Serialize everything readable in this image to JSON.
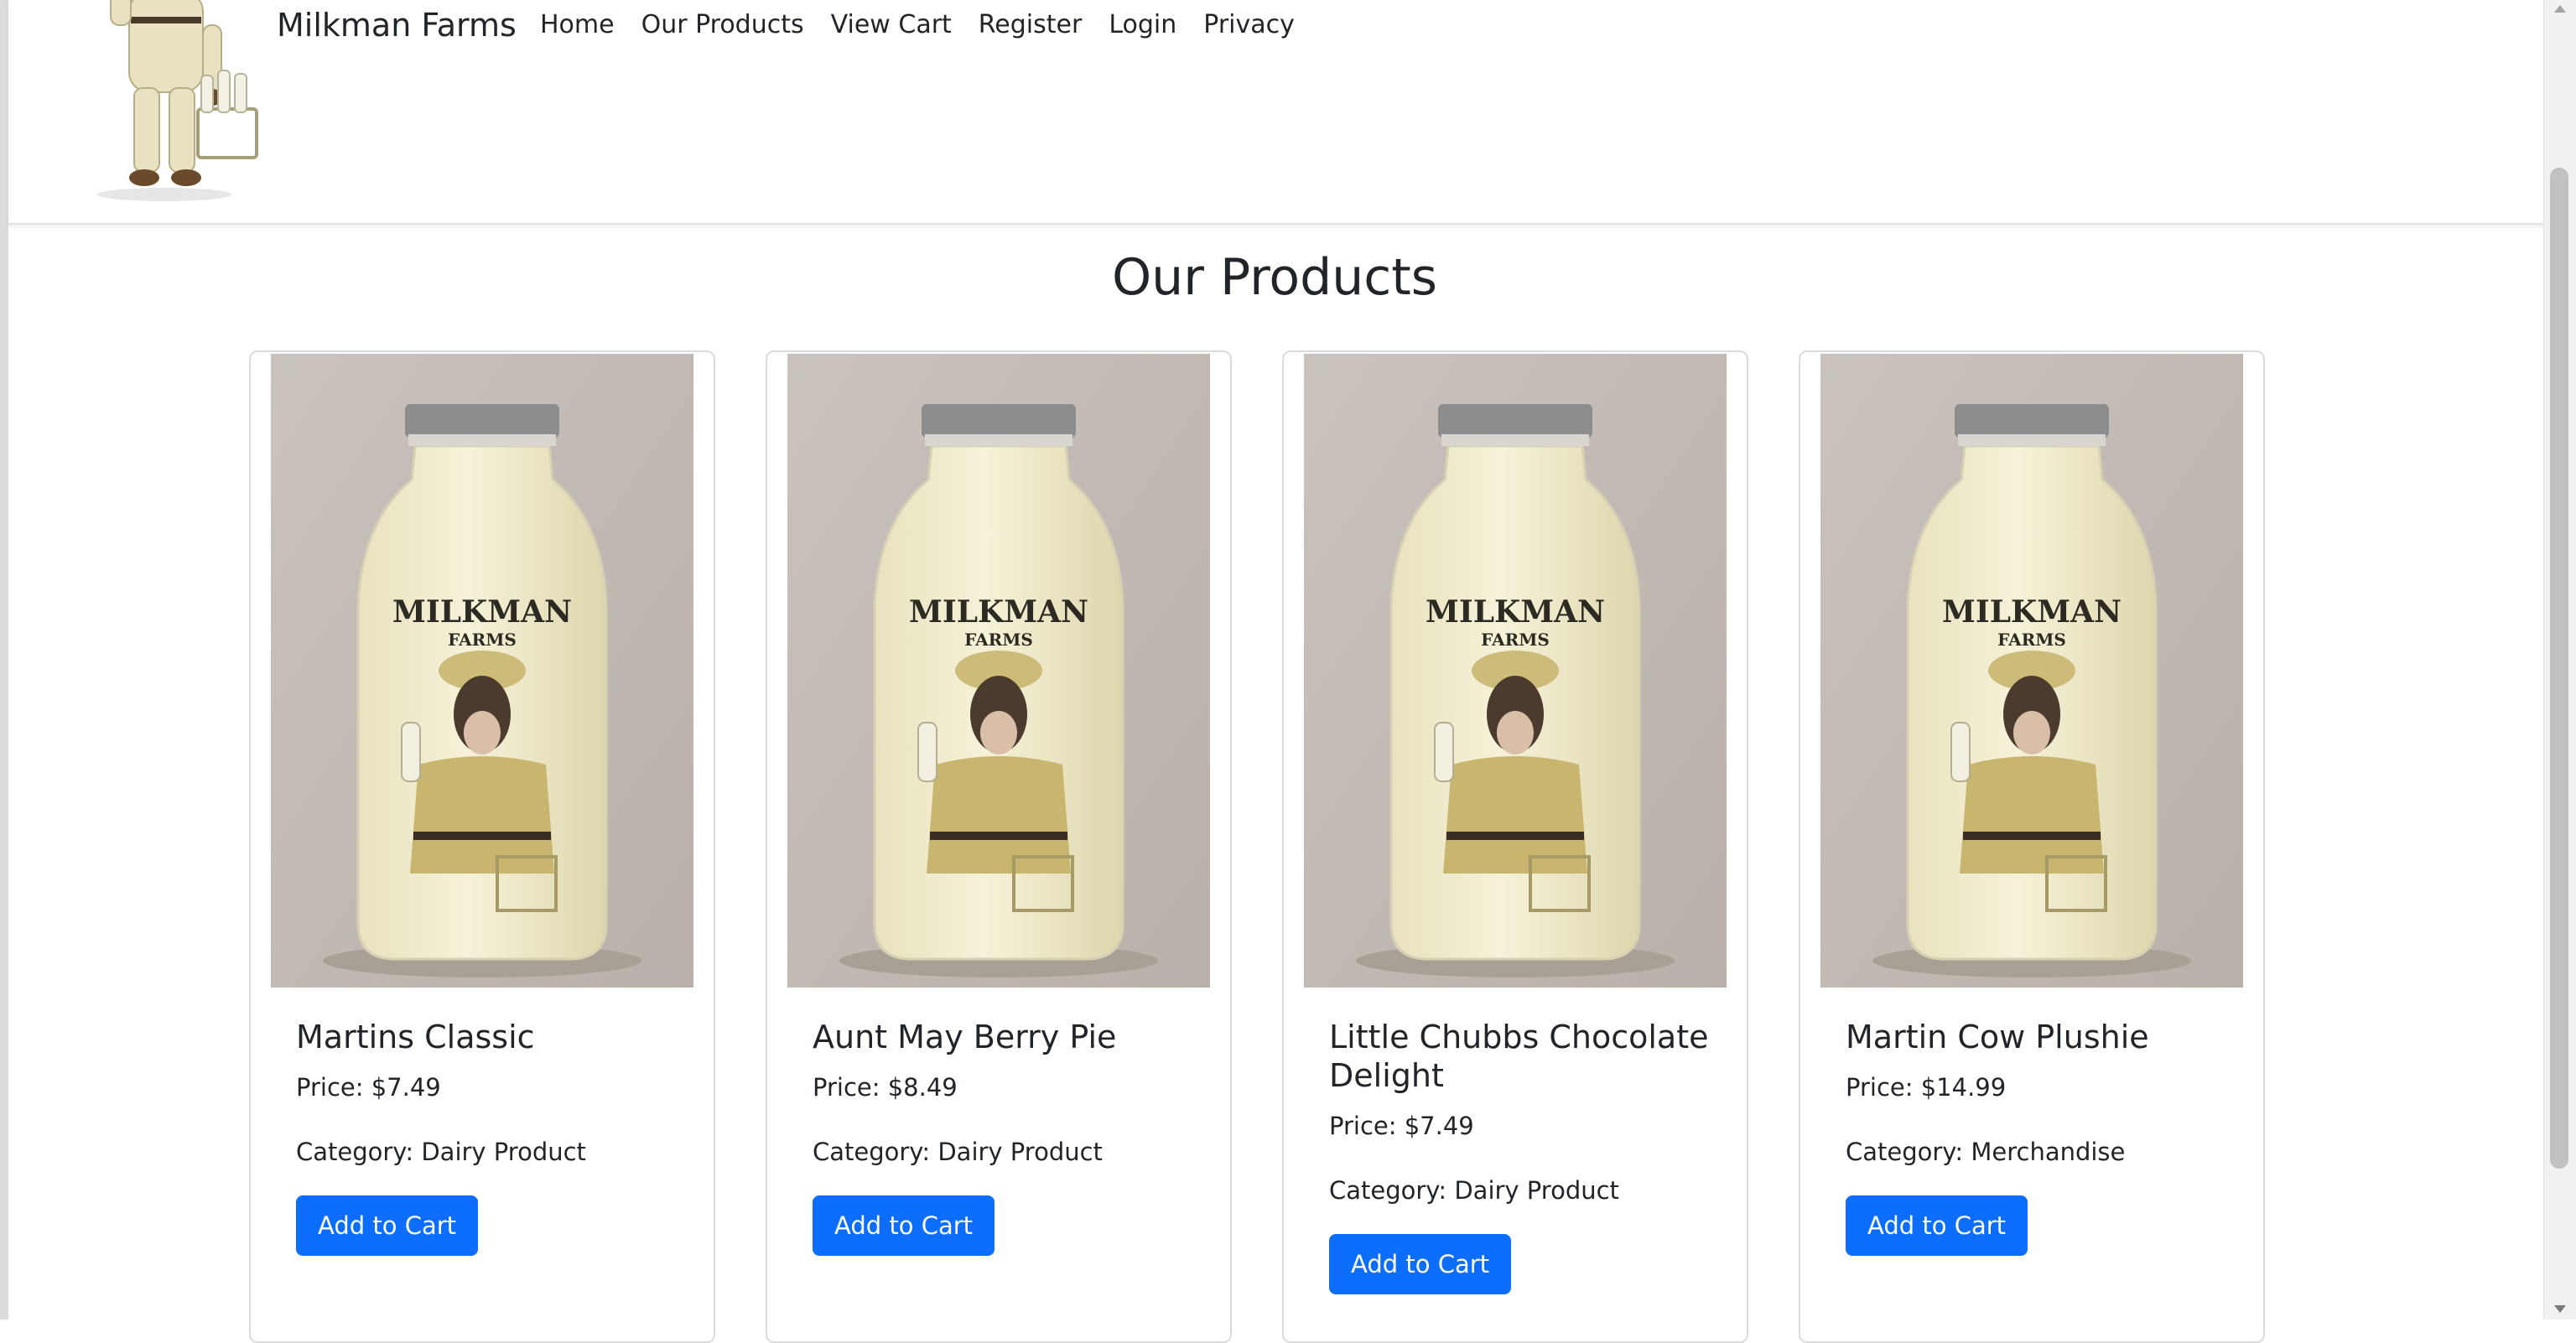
{
  "header": {
    "brand": "Milkman Farms",
    "nav": [
      "Home",
      "Our Products",
      "View Cart",
      "Register",
      "Login",
      "Privacy"
    ]
  },
  "page_title": "Our Products",
  "products": [
    {
      "name": "Martins Classic",
      "price": "Price: $7.49",
      "category": "Category: Dairy Product",
      "button": "Add to Cart",
      "bottle_brand": "MILKMAN",
      "bottle_sub": "FARMS"
    },
    {
      "name": "Aunt May Berry Pie",
      "price": "Price: $8.49",
      "category": "Category: Dairy Product",
      "button": "Add to Cart",
      "bottle_brand": "MILKMAN",
      "bottle_sub": "FARMS"
    },
    {
      "name": "Little Chubbs Chocolate Delight",
      "price": "Price: $7.49",
      "category": "Category: Dairy Product",
      "button": "Add to Cart",
      "bottle_brand": "MILKMAN",
      "bottle_sub": "FARMS"
    },
    {
      "name": "Martin Cow Plushie",
      "price": "Price: $14.99",
      "category": "Category: Merchandise",
      "button": "Add to Cart",
      "bottle_brand": "MILKMAN",
      "bottle_sub": "FARMS"
    }
  ],
  "colors": {
    "primary_button": "#0d6efd",
    "text": "#212529"
  }
}
